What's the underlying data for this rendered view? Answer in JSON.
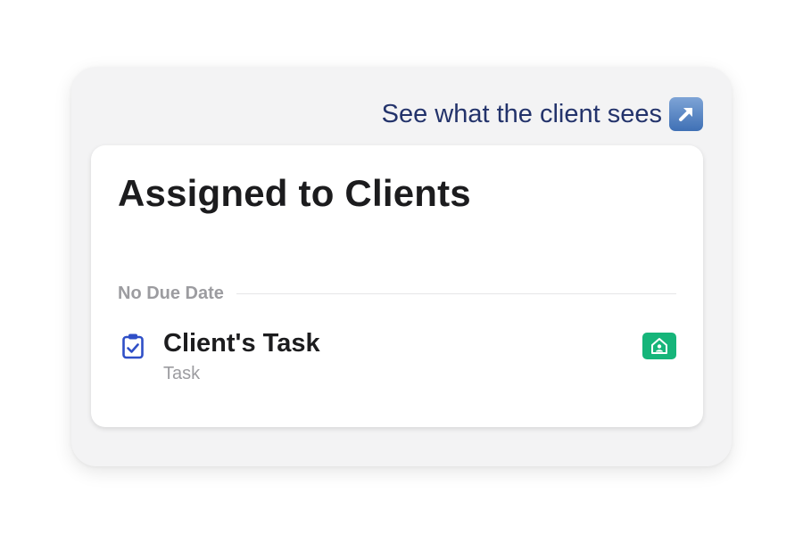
{
  "header": {
    "client_view_link": "See what the client sees",
    "client_view_icon": "external-arrow-icon",
    "link_color": "#23336b"
  },
  "card": {
    "title": "Assigned to Clients",
    "section": {
      "label": "No Due Date",
      "tasks": [
        {
          "title": "Client's Task",
          "type": "Task",
          "icon": "clipboard-check-icon",
          "badge_icon": "client-home-icon",
          "badge_color": "#16b57a"
        }
      ]
    }
  }
}
